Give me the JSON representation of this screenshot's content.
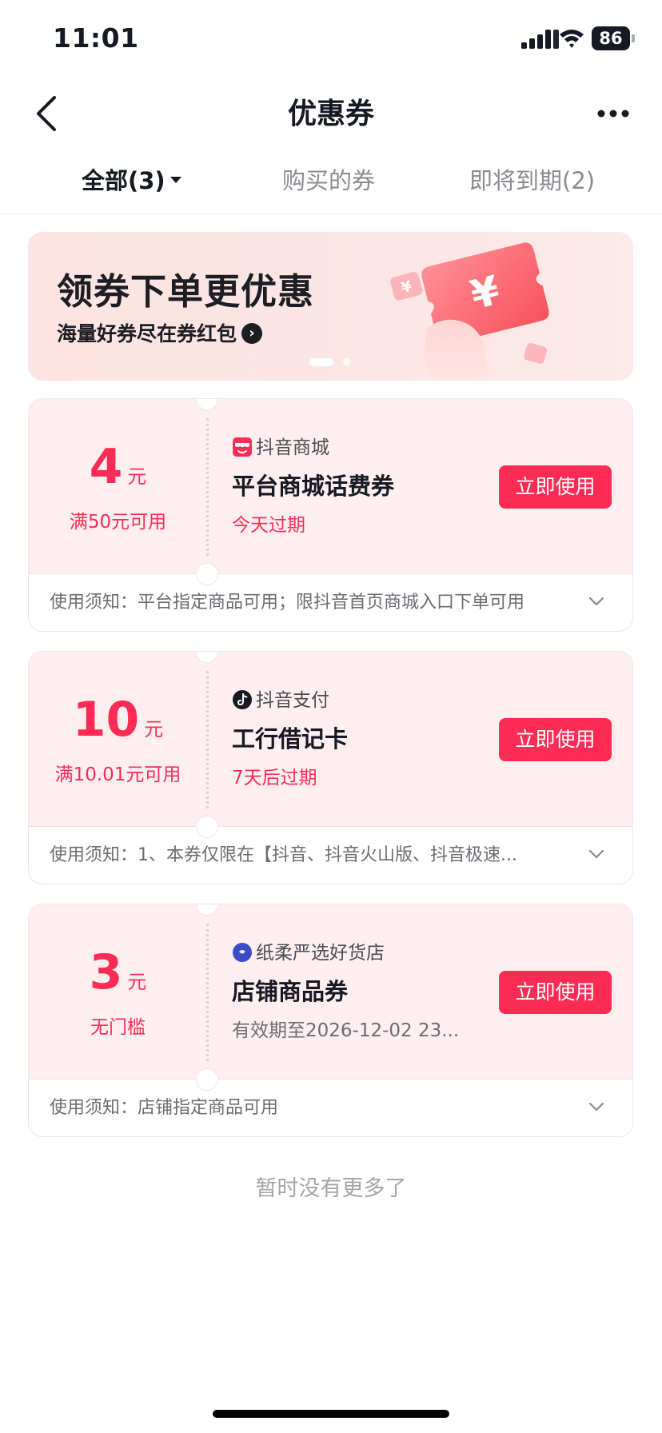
{
  "status_bar": {
    "time": "11:01",
    "battery": "86"
  },
  "nav": {
    "title": "优惠券"
  },
  "tabs": [
    {
      "label": "全部(3)"
    },
    {
      "label": "购买的券"
    },
    {
      "label": "即将到期(2)"
    }
  ],
  "banner": {
    "title": "领券下单更优惠",
    "subtitle": "海量好券尽在券红包",
    "arrow": "›",
    "currency_glyph": "¥"
  },
  "coupons": [
    {
      "amount": "4",
      "unit": "元",
      "threshold": "满50元可用",
      "merchant": "抖音商城",
      "merchant_icon": "store-icon",
      "name": "平台商城话费券",
      "expiry": "今天过期",
      "button": "立即使用",
      "notice": "使用须知：平台指定商品可用；限抖音首页商城入口下单可用"
    },
    {
      "amount": "10",
      "unit": "元",
      "threshold": "满10.01元可用",
      "merchant": "抖音支付",
      "merchant_icon": "douyin-logo-icon",
      "name": "工行借记卡",
      "expiry": "7天后过期",
      "button": "立即使用",
      "notice": "使用须知：1、本券仅限在【抖音、抖音火山版、抖音极速..."
    },
    {
      "amount": "3",
      "unit": "元",
      "threshold": "无门槛",
      "merchant": "纸柔严选好货店",
      "merchant_icon": "shop-avatar-icon",
      "name": "店铺商品券",
      "expiry": "有效期至2026-12-02 23...",
      "button": "立即使用",
      "notice": "使用须知：店铺指定商品可用"
    }
  ],
  "footer": {
    "no_more": "暂时没有更多了"
  },
  "colors": {
    "accent": "#fe2c55",
    "card_bg": "#fdeff0",
    "banner_bg": "#fde3e1"
  }
}
